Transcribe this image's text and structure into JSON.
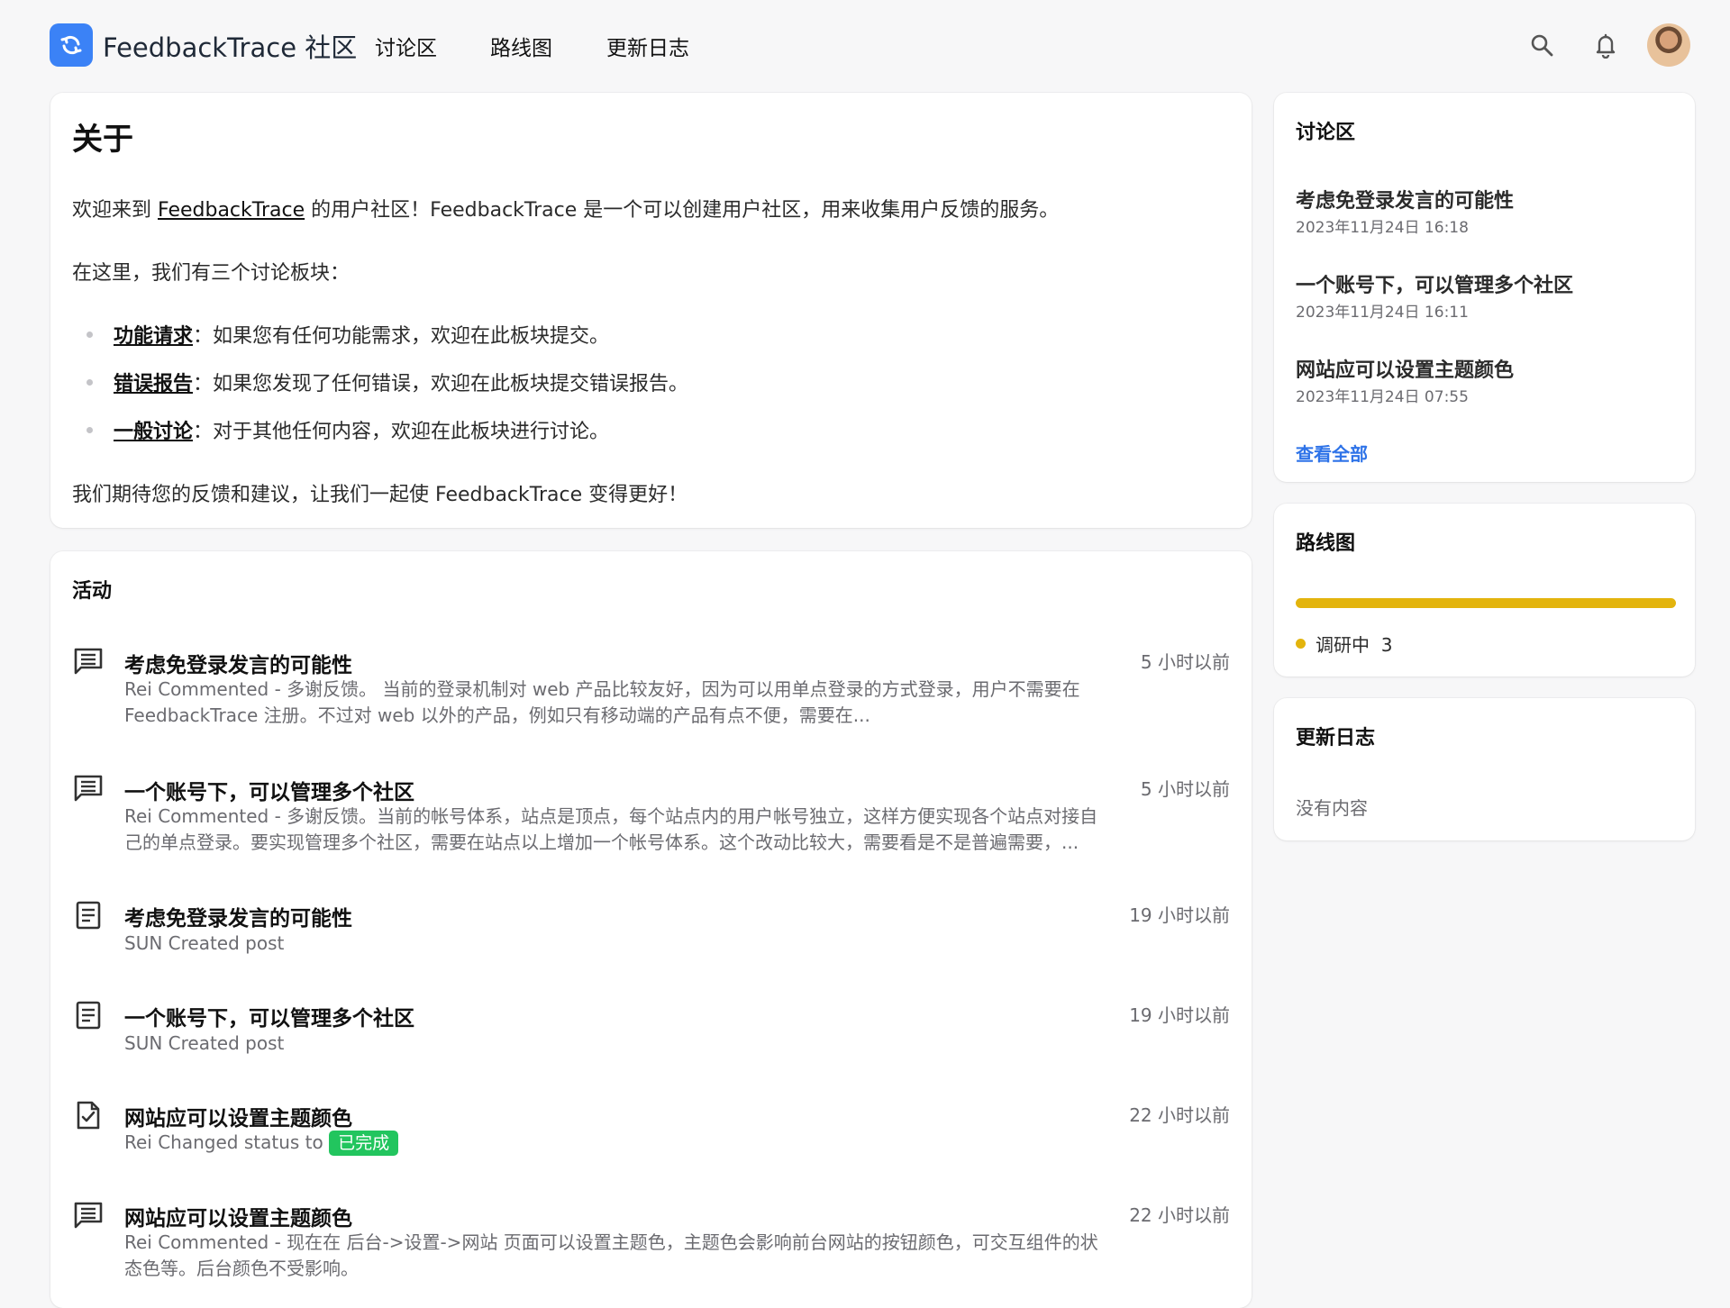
{
  "header": {
    "brand": "FeedbackTrace 社区",
    "nav": [
      "讨论区",
      "路线图",
      "更新日志"
    ],
    "icons": [
      "search-icon",
      "bell-icon"
    ]
  },
  "about": {
    "title": "关于",
    "intro_prefix": "欢迎来到 ",
    "intro_link": "FeedbackTrace",
    "intro_suffix": " 的用户社区！FeedbackTrace 是一个可以创建用户社区，用来收集用户反馈的服务。",
    "boards_intro": "在这里，我们有三个讨论板块：",
    "boards": [
      {
        "name": "功能请求",
        "desc": "：如果您有任何功能需求，欢迎在此板块提交。"
      },
      {
        "name": "错误报告",
        "desc": "：如果您发现了任何错误，欢迎在此板块提交错误报告。"
      },
      {
        "name": "一般讨论",
        "desc": "：对于其他任何内容，欢迎在此板块进行讨论。"
      }
    ],
    "closing": "我们期待您的反馈和建议，让我们一起使 FeedbackTrace 变得更好！"
  },
  "activity": {
    "title": "活动",
    "items": [
      {
        "icon": "comment-icon",
        "title": "考虑免登录发言的可能性",
        "desc": "Rei Commented - 多谢反馈。 当前的登录机制对 web 产品比较友好，因为可以用单点登录的方式登录，用户不需要在 FeedbackTrace 注册。不过对 web 以外的产品，例如只有移动端的产品有点不便，需要在...",
        "time": "5 小时以前"
      },
      {
        "icon": "comment-icon",
        "title": "一个账号下，可以管理多个社区",
        "desc": "Rei Commented - 多谢反馈。当前的帐号体系，站点是顶点，每个站点内的用户帐号独立，这样方便实现各个站点对接自己的单点登录。要实现管理多个社区，需要在站点以上增加一个帐号体系。这个改动比较大，需要看是不是普遍需要，...",
        "time": "5 小时以前"
      },
      {
        "icon": "document-icon",
        "title": "考虑免登录发言的可能性",
        "desc": "SUN Created post",
        "time": "19 小时以前"
      },
      {
        "icon": "document-icon",
        "title": "一个账号下，可以管理多个社区",
        "desc": "SUN Created post",
        "time": "19 小时以前"
      },
      {
        "icon": "file-check-icon",
        "title": "网站应可以设置主题颜色",
        "desc": "Rei Changed status to",
        "badge": "已完成",
        "time": "22 小时以前"
      },
      {
        "icon": "comment-icon",
        "title": "网站应可以设置主题颜色",
        "desc": "Rei Commented - 现在在 后台->设置->网站 页面可以设置主题色，主题色会影响前台网站的按钮颜色，可交互组件的状态色等。后台颜色不受影响。",
        "time": "22 小时以前"
      }
    ]
  },
  "sidebar": {
    "discussions": {
      "title": "讨论区",
      "items": [
        {
          "title": "考虑免登录发言的可能性",
          "date": "2023年11月24日 16:18"
        },
        {
          "title": "一个账号下，可以管理多个社区",
          "date": "2023年11月24日 16:11"
        },
        {
          "title": "网站应可以设置主题颜色",
          "date": "2023年11月24日 07:55"
        }
      ],
      "view_all": "查看全部"
    },
    "roadmap": {
      "title": "路线图",
      "status_label": "调研中",
      "status_count": "3",
      "status_color": "#e3b40d"
    },
    "changelog": {
      "title": "更新日志",
      "empty": "没有内容"
    }
  },
  "colors": {
    "brand": "#3b82f6",
    "link": "#2e73e8",
    "success": "#22c55e",
    "roadmap": "#e3b40d"
  }
}
